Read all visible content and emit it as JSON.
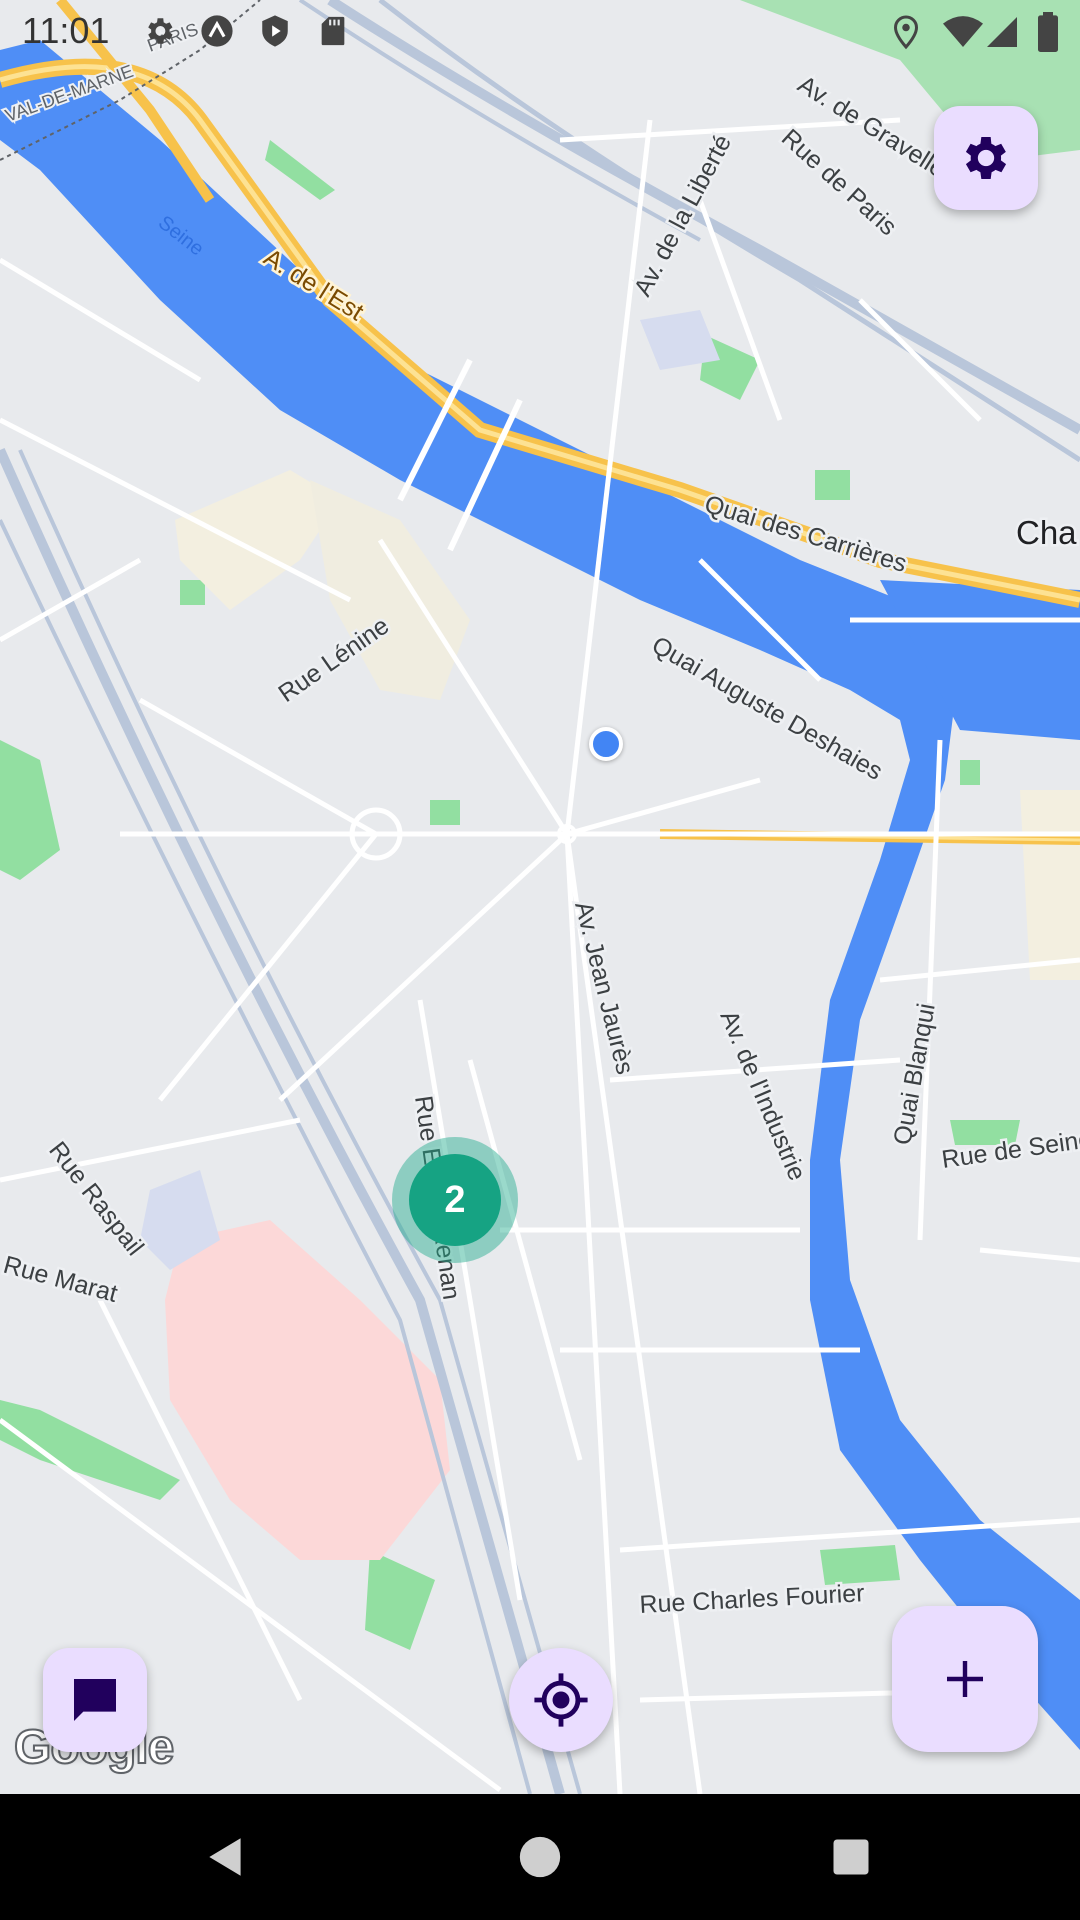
{
  "status_bar": {
    "time": "11:01",
    "left_icons": [
      "settings-gear-icon",
      "arrow-up-circle-icon",
      "play-shield-icon",
      "sd-card-icon"
    ],
    "right_icons": [
      "location-pin-icon",
      "wifi-icon",
      "cell-signal-icon",
      "battery-icon"
    ]
  },
  "map": {
    "labels": {
      "region_1": "VAL-DE-MARNE",
      "region_2": "PARIS",
      "river": "Seine",
      "highway": "A. de l'Est",
      "quai_carrieres": "Quai des Carrières",
      "liberte": "Av. de la Liberté",
      "gravelle": "Av. de Gravelle",
      "paris": "Rue de Paris",
      "place": "Cha",
      "lenine": "Rue Lénine",
      "deshaies": "Quai Auguste Deshaies",
      "jaures": "Av. Jean Jaurès",
      "industrie": "Av. de l'Industrie",
      "blanqui": "Quai Blanqui",
      "seine_rue": "Rue de Seine",
      "raspail": "Rue Raspail",
      "marat": "Rue Marat",
      "renan": "Rue Ernest Renan",
      "fourier": "Rue Charles Fourier"
    },
    "cluster_count": "2",
    "attribution": "Google"
  },
  "buttons": {
    "settings_icon": "gear-icon",
    "add_icon": "plus-icon",
    "chat_icon": "chat-bubble-icon",
    "locate_icon": "my-location-crosshair-icon"
  },
  "nav_bar": {
    "icons": [
      "back-triangle-icon",
      "home-circle-icon",
      "recents-square-icon"
    ]
  },
  "colors": {
    "water": "#4f8ef6",
    "park": "#92dfa1",
    "highway": "#f7c24b",
    "fab_bg": "#eaddff",
    "fab_icon": "#21005d",
    "cluster": "#16a383"
  }
}
